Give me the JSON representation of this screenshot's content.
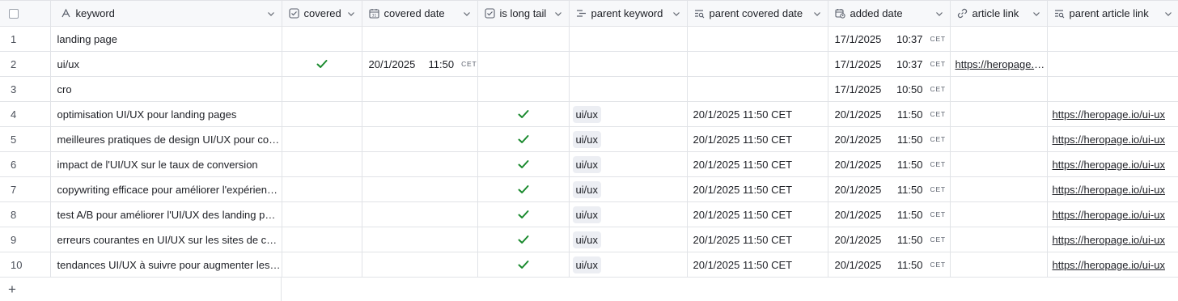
{
  "columns": [
    {
      "key": "keyword",
      "label": "keyword",
      "icon": "text-field-icon"
    },
    {
      "key": "covered",
      "label": "covered",
      "icon": "checkbox-field-icon"
    },
    {
      "key": "covered_date",
      "label": "covered date",
      "icon": "calendar-icon"
    },
    {
      "key": "is_long_tail",
      "label": "is long tail",
      "icon": "checkbox-field-icon"
    },
    {
      "key": "parent_keyword",
      "label": "parent keyword",
      "icon": "linked-record-icon"
    },
    {
      "key": "parent_covered_date",
      "label": "parent covered date",
      "icon": "lookup-icon"
    },
    {
      "key": "added_date",
      "label": "added date",
      "icon": "calendar-clock-icon"
    },
    {
      "key": "article_link",
      "label": "article link",
      "icon": "link-icon"
    },
    {
      "key": "parent_article_link",
      "label": "parent article link",
      "icon": "lookup-icon"
    }
  ],
  "rows": [
    {
      "num": "1",
      "keyword": "landing page",
      "covered": false,
      "covered_date": "",
      "covered_time": "",
      "covered_tz": "",
      "is_long_tail": false,
      "parent_keyword": "",
      "parent_covered_date": "",
      "added_date": "17/1/2025",
      "added_time": "10:37",
      "added_tz": "CET",
      "article_link": "",
      "parent_article_link": ""
    },
    {
      "num": "2",
      "keyword": "ui/ux",
      "covered": true,
      "covered_date": "20/1/2025",
      "covered_time": "11:50",
      "covered_tz": "CET",
      "is_long_tail": false,
      "parent_keyword": "",
      "parent_covered_date": "",
      "added_date": "17/1/2025",
      "added_time": "10:37",
      "added_tz": "CET",
      "article_link": "https://heropage.io/ui-ux",
      "parent_article_link": ""
    },
    {
      "num": "3",
      "keyword": "cro",
      "covered": false,
      "covered_date": "",
      "covered_time": "",
      "covered_tz": "",
      "is_long_tail": false,
      "parent_keyword": "",
      "parent_covered_date": "",
      "added_date": "17/1/2025",
      "added_time": "10:50",
      "added_tz": "CET",
      "article_link": "",
      "parent_article_link": ""
    },
    {
      "num": "4",
      "keyword": "optimisation UI/UX pour landing pages",
      "covered": false,
      "covered_date": "",
      "covered_time": "",
      "covered_tz": "",
      "is_long_tail": true,
      "parent_keyword": "ui/ux",
      "parent_covered_date": "20/1/2025 11:50 CET",
      "added_date": "20/1/2025",
      "added_time": "11:50",
      "added_tz": "CET",
      "article_link": "",
      "parent_article_link": "https://heropage.io/ui-ux"
    },
    {
      "num": "5",
      "keyword": "meilleures pratiques de design UI/UX pour conversion",
      "covered": false,
      "covered_date": "",
      "covered_time": "",
      "covered_tz": "",
      "is_long_tail": true,
      "parent_keyword": "ui/ux",
      "parent_covered_date": "20/1/2025 11:50 CET",
      "added_date": "20/1/2025",
      "added_time": "11:50",
      "added_tz": "CET",
      "article_link": "",
      "parent_article_link": "https://heropage.io/ui-ux"
    },
    {
      "num": "6",
      "keyword": "impact de l'UI/UX sur le taux de conversion",
      "covered": false,
      "covered_date": "",
      "covered_time": "",
      "covered_tz": "",
      "is_long_tail": true,
      "parent_keyword": "ui/ux",
      "parent_covered_date": "20/1/2025 11:50 CET",
      "added_date": "20/1/2025",
      "added_time": "11:50",
      "added_tz": "CET",
      "article_link": "",
      "parent_article_link": "https://heropage.io/ui-ux"
    },
    {
      "num": "7",
      "keyword": "copywriting efficace pour améliorer l'expérience utilisateur",
      "covered": false,
      "covered_date": "",
      "covered_time": "",
      "covered_tz": "",
      "is_long_tail": true,
      "parent_keyword": "ui/ux",
      "parent_covered_date": "20/1/2025 11:50 CET",
      "added_date": "20/1/2025",
      "added_time": "11:50",
      "added_tz": "CET",
      "article_link": "",
      "parent_article_link": "https://heropage.io/ui-ux"
    },
    {
      "num": "8",
      "keyword": "test A/B pour améliorer l'UI/UX des landing pages",
      "covered": false,
      "covered_date": "",
      "covered_time": "",
      "covered_tz": "",
      "is_long_tail": true,
      "parent_keyword": "ui/ux",
      "parent_covered_date": "20/1/2025 11:50 CET",
      "added_date": "20/1/2025",
      "added_time": "11:50",
      "added_tz": "CET",
      "article_link": "",
      "parent_article_link": "https://heropage.io/ui-ux"
    },
    {
      "num": "9",
      "keyword": "erreurs courantes en UI/UX sur les sites de conversion",
      "covered": false,
      "covered_date": "",
      "covered_time": "",
      "covered_tz": "",
      "is_long_tail": true,
      "parent_keyword": "ui/ux",
      "parent_covered_date": "20/1/2025 11:50 CET",
      "added_date": "20/1/2025",
      "added_time": "11:50",
      "added_tz": "CET",
      "article_link": "",
      "parent_article_link": "https://heropage.io/ui-ux"
    },
    {
      "num": "10",
      "keyword": "tendances UI/UX à suivre pour augmenter les conversions",
      "covered": false,
      "covered_date": "",
      "covered_time": "",
      "covered_tz": "",
      "is_long_tail": true,
      "parent_keyword": "ui/ux",
      "parent_covered_date": "20/1/2025 11:50 CET",
      "added_date": "20/1/2025",
      "added_time": "11:50",
      "added_tz": "CET",
      "article_link": "",
      "parent_article_link": "https://heropage.io/ui-ux"
    }
  ],
  "add_row": {
    "label": "+",
    "icon": "plus-icon"
  },
  "colors": {
    "check": "#1a8a2e",
    "header_bg": "#f7f8fa",
    "grid_line": "#e1e3e7",
    "pill_bg": "#eceef3"
  }
}
